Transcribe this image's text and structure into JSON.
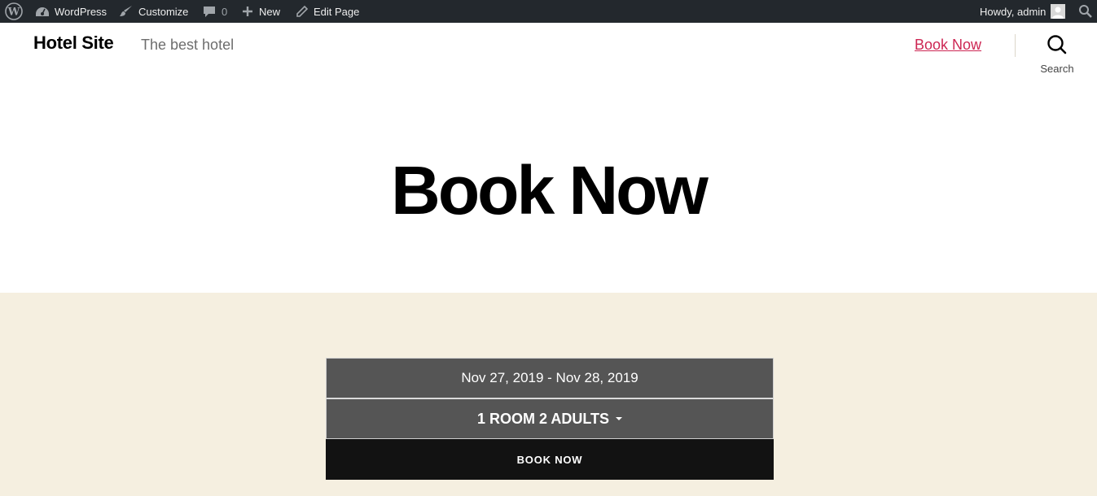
{
  "adminbar": {
    "wp_label": "WordPress",
    "customize_label": "Customize",
    "comments_count": "0",
    "new_label": "New",
    "edit_label": "Edit Page",
    "howdy": "Howdy, admin"
  },
  "header": {
    "site_title": "Hotel Site",
    "tagline": "The best hotel",
    "nav_book": "Book Now",
    "search_label": "Search"
  },
  "main": {
    "page_title": "Book Now",
    "booking": {
      "dates": "Nov 27, 2019 - Nov 28, 2019",
      "guests": "1 ROOM 2 ADULTS",
      "submit": "BOOK NOW"
    }
  },
  "colors": {
    "adminbar_bg": "#23282d",
    "link_accent": "#cd2653",
    "content_bg": "#f5efe0",
    "field_bg": "#555555",
    "button_bg": "#121212"
  }
}
